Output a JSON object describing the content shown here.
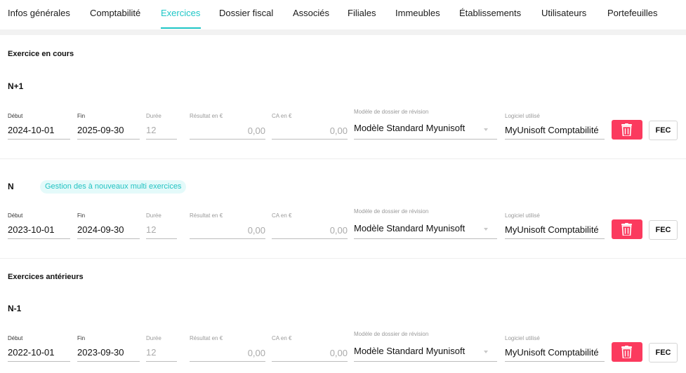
{
  "tabs": [
    {
      "label": "Infos générales",
      "active": false
    },
    {
      "label": "Comptabilité",
      "active": false
    },
    {
      "label": "Exercices",
      "active": true
    },
    {
      "label": "Dossier fiscal",
      "active": false
    },
    {
      "label": "Associés",
      "active": false
    },
    {
      "label": "Filiales",
      "active": false
    },
    {
      "label": "Immeubles",
      "active": false
    },
    {
      "label": "Établissements",
      "active": false
    },
    {
      "label": "Utilisateurs",
      "active": false
    },
    {
      "label": "Portefeuilles",
      "active": false
    }
  ],
  "colors": {
    "accent": "#1ec6c6",
    "delete": "#fb3a5e"
  },
  "sections": {
    "current": "Exercice en cours",
    "previous": "Exercices antérieurs"
  },
  "labels": {
    "debut": "Début",
    "fin": "Fin",
    "duree": "Durée",
    "resultat": "Résultat en €",
    "ca": "CA en €",
    "modele": "Modèle de dossier de révision",
    "logiciel": "Logiciel utilisé",
    "fec": "FEC"
  },
  "exercises": [
    {
      "title": "N+1",
      "badge": "",
      "debut": "2024-10-01",
      "fin": "2025-09-30",
      "duree": "12",
      "resultat": "0,00",
      "ca": "0,00",
      "modele": "Modèle Standard Myunisoft",
      "logiciel": "MyUnisoft Comptabilité"
    },
    {
      "title": "N",
      "badge": "Gestion des à nouveaux multi exercices",
      "debut": "2023-10-01",
      "fin": "2024-09-30",
      "duree": "12",
      "resultat": "0,00",
      "ca": "0,00",
      "modele": "Modèle Standard Myunisoft",
      "logiciel": "MyUnisoft Comptabilité"
    },
    {
      "title": "N-1",
      "badge": "",
      "debut": "2022-10-01",
      "fin": "2023-09-30",
      "duree": "12",
      "resultat": "0,00",
      "ca": "0,00",
      "modele": "Modèle Standard Myunisoft",
      "logiciel": "MyUnisoft Comptabilité"
    }
  ],
  "icons": {
    "delete": "trash-icon",
    "dropdown": "chevron-down-icon"
  }
}
